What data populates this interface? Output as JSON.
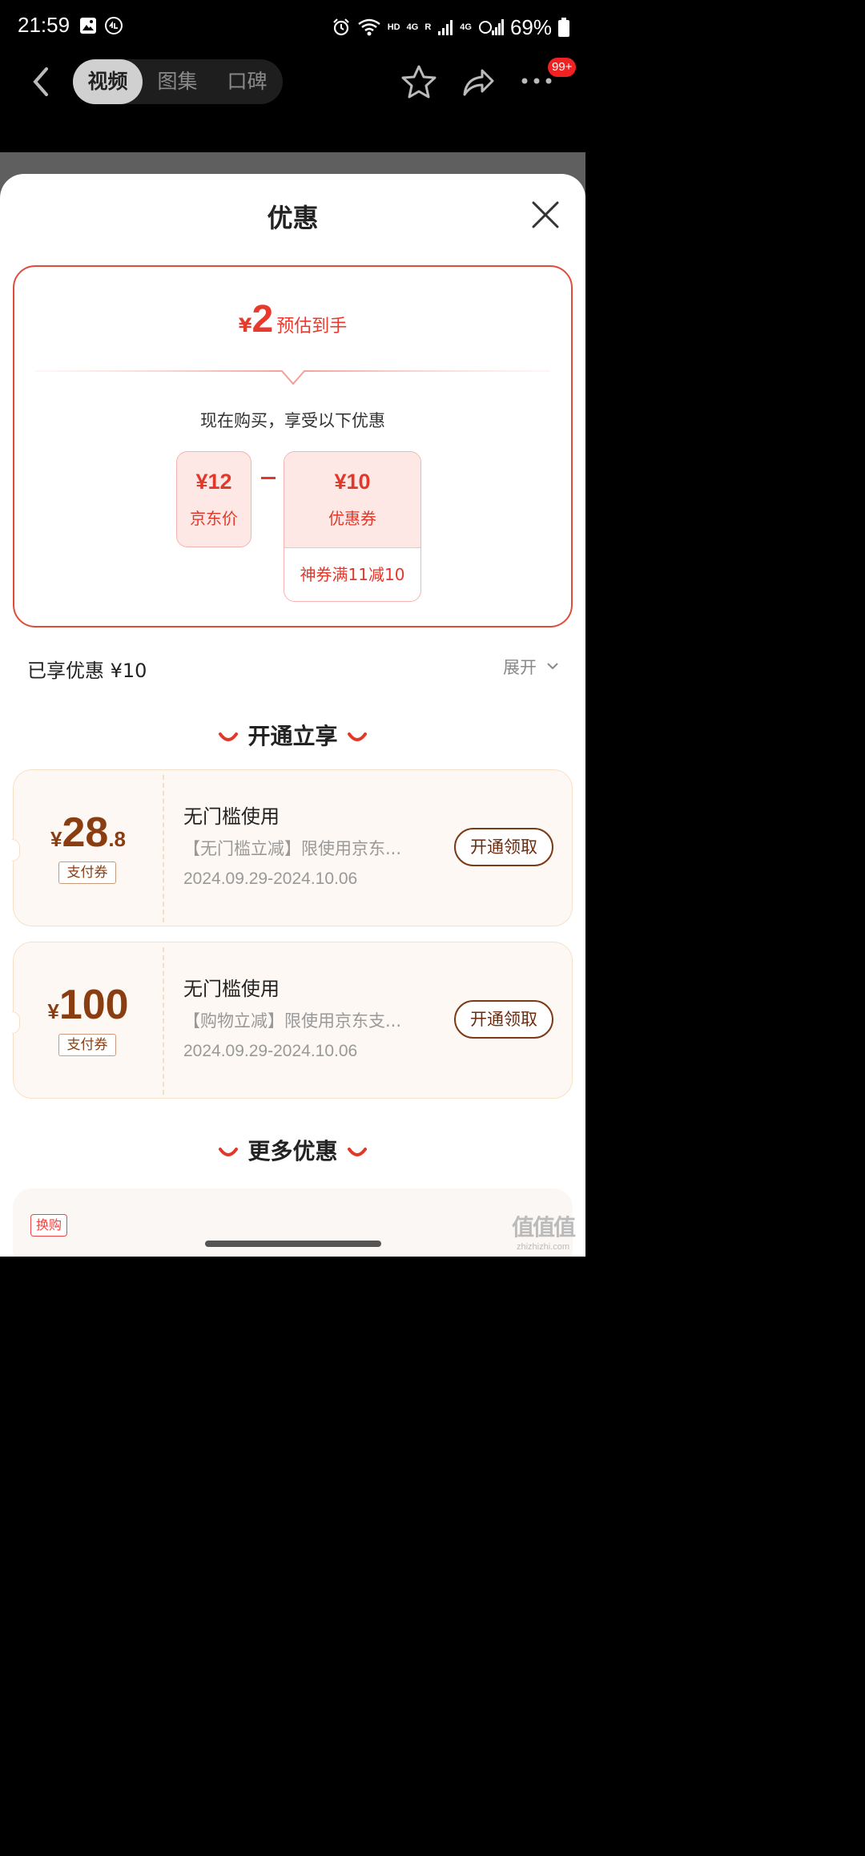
{
  "status_bar": {
    "time": "21:59",
    "net_hd": "HD",
    "net_4g_1": "4G",
    "net_r": "R",
    "net_4g_2": "4G",
    "battery": "69%"
  },
  "nav": {
    "tabs": [
      {
        "label": "视频",
        "active": true
      },
      {
        "label": "图集",
        "active": false
      },
      {
        "label": "口碑",
        "active": false
      }
    ],
    "badge": "99+"
  },
  "sheet": {
    "title": "优惠",
    "estimate": {
      "currency": "¥",
      "value": "2",
      "label": "预估到手"
    },
    "buy_text": "现在购买，享受以下优惠",
    "jd_price": {
      "value": "¥12",
      "label": "京东价"
    },
    "coupon_price": {
      "value": "¥10",
      "label": "优惠券",
      "sub": "神券满11减10"
    },
    "enjoyed": "已享优惠 ¥10",
    "expand": "展开",
    "section_open": "开通立享",
    "coupons": [
      {
        "currency": "¥",
        "amount": "28",
        "decimal": ".8",
        "tag": "支付券",
        "title": "无门槛使用",
        "desc": "【无门槛立减】限使用京东...",
        "date": "2024.09.29-2024.10.06",
        "button": "开通领取"
      },
      {
        "currency": "¥",
        "amount": "100",
        "decimal": "",
        "tag": "支付券",
        "title": "无门槛使用",
        "desc": "【购物立减】限使用京东支...",
        "date": "2024.09.29-2024.10.06",
        "button": "开通领取"
      }
    ],
    "section_more": "更多优惠",
    "more_tag": "换购"
  },
  "watermark": {
    "top": "值值值",
    "bottom": "zhizhizhi.com"
  },
  "colors": {
    "accent": "#e83a2c",
    "coupon_brown": "#8b3d12"
  }
}
